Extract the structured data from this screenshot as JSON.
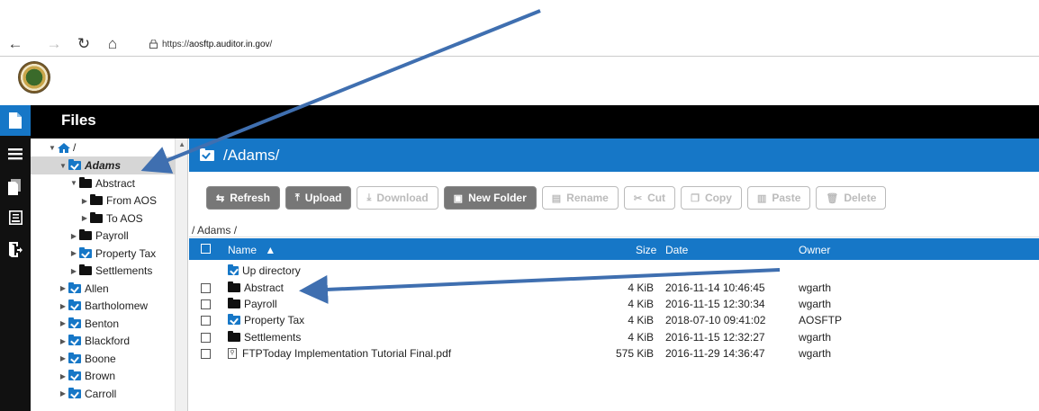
{
  "browser": {
    "url_prefix": "https://",
    "url_host": "aosftp.auditor.in.gov",
    "url_suffix": "/",
    "back_glyph": "←",
    "forward_glyph": "→",
    "refresh_glyph": "↻",
    "home_glyph": "⌂"
  },
  "app": {
    "title": "Files"
  },
  "tree": {
    "root_label": "/",
    "items": [
      {
        "label": "Adams",
        "caret": "▼",
        "icon": "folder-check-icon"
      },
      {
        "label": "Abstract",
        "caret": "▼",
        "icon": "folder-icon"
      },
      {
        "label": "From AOS",
        "caret": "▶",
        "icon": "folder-icon"
      },
      {
        "label": "To AOS",
        "caret": "▶",
        "icon": "folder-icon"
      },
      {
        "label": "Payroll",
        "caret": "▶",
        "icon": "folder-icon"
      },
      {
        "label": "Property Tax",
        "caret": "▶",
        "icon": "folder-check-icon"
      },
      {
        "label": "Settlements",
        "caret": "▶",
        "icon": "folder-icon"
      },
      {
        "label": "Allen",
        "caret": "▶",
        "icon": "folder-check-icon"
      },
      {
        "label": "Bartholomew",
        "caret": "▶",
        "icon": "folder-check-icon"
      },
      {
        "label": "Benton",
        "caret": "▶",
        "icon": "folder-check-icon"
      },
      {
        "label": "Blackford",
        "caret": "▶",
        "icon": "folder-check-icon"
      },
      {
        "label": "Boone",
        "caret": "▶",
        "icon": "folder-check-icon"
      },
      {
        "label": "Brown",
        "caret": "▶",
        "icon": "folder-check-icon"
      },
      {
        "label": "Carroll",
        "caret": "▶",
        "icon": "folder-check-icon"
      }
    ]
  },
  "main": {
    "header_path": "/Adams/",
    "breadcrumb": "/ Adams /",
    "toolbar": {
      "refresh": "Refresh",
      "upload": "Upload",
      "download": "Download",
      "new_folder": "New Folder",
      "rename": "Rename",
      "cut": "Cut",
      "copy": "Copy",
      "paste": "Paste",
      "delete": "Delete"
    },
    "columns": {
      "name": "Name",
      "sort_glyph": "▲",
      "size": "Size",
      "date": "Date",
      "owner": "Owner"
    },
    "up_directory": "Up directory",
    "rows": [
      {
        "name": "Abstract",
        "size": "4 KiB",
        "date": "2016-11-14 10:46:45",
        "owner": "wgarth",
        "icon": "folder-icon"
      },
      {
        "name": "Payroll",
        "size": "4 KiB",
        "date": "2016-11-15 12:30:34",
        "owner": "wgarth",
        "icon": "folder-icon"
      },
      {
        "name": "Property Tax",
        "size": "4 KiB",
        "date": "2018-07-10 09:41:02",
        "owner": "AOSFTP",
        "icon": "folder-check-icon"
      },
      {
        "name": "Settlements",
        "size": "4 KiB",
        "date": "2016-11-15 12:32:27",
        "owner": "wgarth",
        "icon": "folder-icon"
      },
      {
        "name": "FTPToday Implementation Tutorial Final.pdf",
        "size": "575 KiB",
        "date": "2016-11-29 14:36:47",
        "owner": "wgarth",
        "icon": "pdf-icon"
      }
    ]
  },
  "colors": {
    "accent": "#1677c7",
    "header_bg": "#000000",
    "button_active": "#777777",
    "arrow": "#3f6fb0"
  }
}
